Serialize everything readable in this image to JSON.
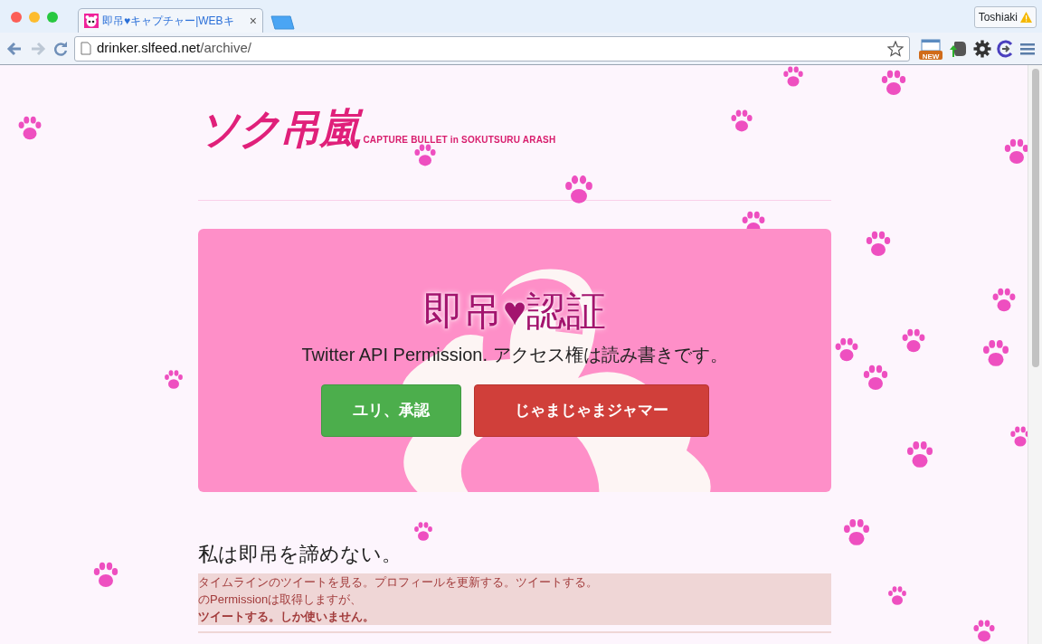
{
  "browser": {
    "tab": {
      "title": "即吊♥キャプチャー|WEBキ",
      "close": "×",
      "selected": true
    },
    "profile": {
      "name": "Toshiaki"
    },
    "extension_badge": "NEW",
    "address": {
      "host": "drinker.slfeed.net",
      "path": "/archive/"
    }
  },
  "logo": {
    "title": "ソク吊嵐",
    "tagline": "CAPTURE BULLET in SOKUTSURU ARASH"
  },
  "hero": {
    "title": "即吊♥認証",
    "subtitle": "Twitter API Permission. アクセス権は読み書きです。",
    "buttons": [
      {
        "label": "ユリ、承認",
        "kind": "success"
      },
      {
        "label": "じゃまじゃまジャマー",
        "kind": "danger"
      }
    ]
  },
  "notice": {
    "heading": "私は即吊を諦めない。",
    "lines": [
      {
        "text": "タイムラインのツイートを見る。プロフィールを更新する。ツイートする。",
        "kind": "plain"
      },
      {
        "text": "のPermissionは取得しますが、",
        "kind": "plain"
      },
      {
        "text": "ツイートする。しか使いません。",
        "kind": "strong"
      }
    ]
  }
}
